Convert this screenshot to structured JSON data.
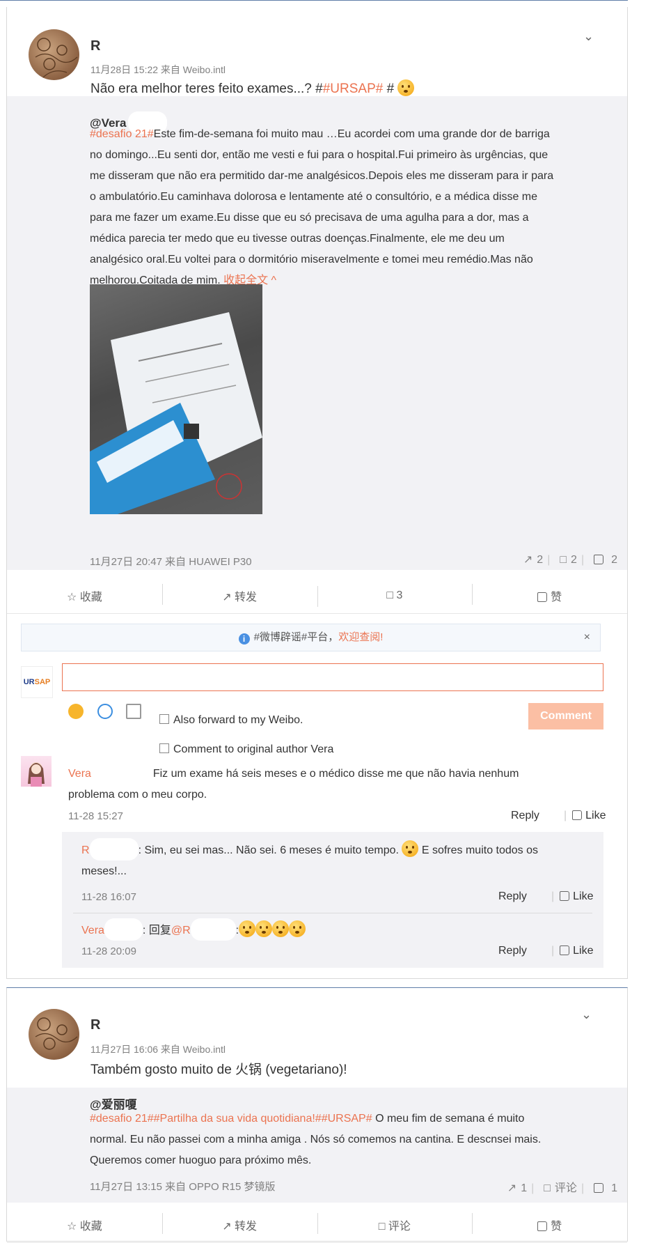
{
  "post1": {
    "username": "R",
    "meta": "11月28日 15:22 来自 Weibo.intl",
    "text_pre": "Não era melhor teres feito exames...? #",
    "hashtag": "#URSAP#",
    "text_post": " #",
    "repost": {
      "author": "@Vera",
      "tag": "#desafio 21#",
      "lines": [
        "Este fim-de-semana foi muito mau …Eu acordei com uma grande dor de barriga",
        "no domingo...Eu senti dor, então me vesti e fui para o hospital.Fui primeiro às urgências, que",
        "me disseram que não era permitido dar-me analgésicos.Depois eles me disseram para ir para",
        "o ambulatório.Eu caminhava dolorosa e lentamente até o consultório, e a médica disse me",
        "para me fazer um exame.Eu disse que eu só precisava de uma agulha para a dor, mas a",
        "médica parecia ter medo que eu tivesse outras doenças.Finalmente, ele me deu um",
        "analgésico oral.Eu voltei para o dormitório miseravelmente e tomei meu remédio.Mas não",
        "melhorou.Coitada de mim."
      ],
      "collapse": "收起全文 ^",
      "meta": "11月27日 20:47 来自 HUAWEI P30",
      "forwards": "2",
      "comments": "2",
      "likes": "2"
    },
    "actions": {
      "favorite": "收藏",
      "forward": "转发",
      "comment": "3",
      "like": "赞"
    }
  },
  "notice": {
    "text": "#微博辟谣#平台，",
    "link": "欢迎查阅!",
    "close": "×"
  },
  "composer": {
    "avatar_text_a": "UR",
    "avatar_text_b": "SAP",
    "forward_label": "Also forward to my Weibo.",
    "original_label": "Comment to original author Vera",
    "submit": "Comment"
  },
  "comments": [
    {
      "author": "Vera",
      "text1": "Fiz um exame há seis meses e o médico disse me  que não havia nenhum",
      "text2": "problema com o meu corpo.",
      "time": "11-28 15:27",
      "reply": "Reply",
      "like": "Like"
    }
  ],
  "subcomments": [
    {
      "author": "R",
      "text": ":  Sim, eu sei mas... Não sei. 6 meses é muito tempo.",
      "text_after": " E sofres muito todos os",
      "text2": "meses!...",
      "time": "11-28 16:07",
      "reply": "Reply",
      "like": "Like"
    },
    {
      "author": "Vera",
      "text": ":  回复",
      "mention": "@R",
      "text_after": ":",
      "time": "11-28 20:09",
      "reply": "Reply",
      "like": "Like"
    }
  ],
  "post2": {
    "username": "R",
    "meta": "11月27日 16:06 来自 Weibo.intl",
    "text": "Também gosto muito de 火锅 (vegetariano)!",
    "repost": {
      "author": "@爱丽嗄",
      "tags": "#desafio 21##Partilha da sua vida quotidiana!##URSAP#",
      "line1": " O meu fim de semana é muito",
      "line2": "normal. Eu não passei com a minha amiga . Nós só comemos na cantina. E descnsei mais.",
      "line3": "Queremos comer huoguo para próximo mês.",
      "meta": "11月27日 13:15 来自 OPPO R15 梦镜版",
      "forwards": "1",
      "comments": "评论",
      "likes": "1"
    },
    "actions": {
      "favorite": "收藏",
      "forward": "转发",
      "comment": "评论",
      "like": "赞"
    }
  }
}
